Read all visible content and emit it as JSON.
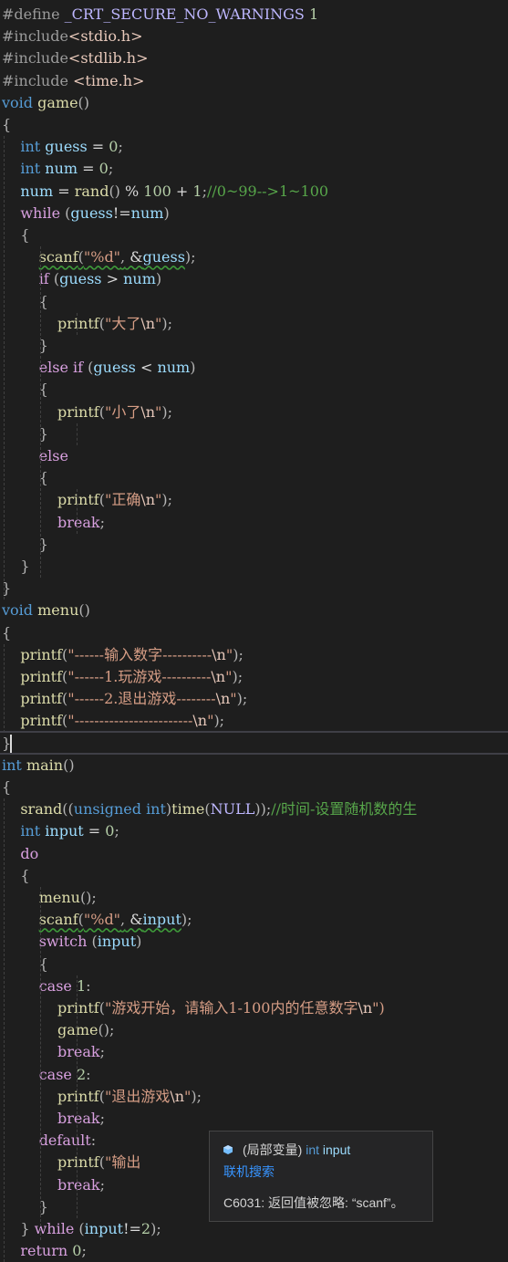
{
  "editor": {
    "lines": [
      [
        [
          "k-pp",
          "#define "
        ],
        [
          "k-macro",
          "_CRT_SECURE_NO_WARNINGS"
        ],
        [
          "k-plain",
          " "
        ],
        [
          "k-num",
          "1"
        ]
      ],
      [
        [
          "k-pp",
          "#include"
        ],
        [
          "k-hdr",
          "<stdio.h>"
        ]
      ],
      [
        [
          "k-pp",
          "#include"
        ],
        [
          "k-hdr",
          "<stdlib.h>"
        ]
      ],
      [
        [
          "k-pp",
          "#include "
        ],
        [
          "k-hdr",
          "<time.h>"
        ]
      ],
      [
        [
          "k-kw",
          "void "
        ],
        [
          "k-fn",
          "game"
        ],
        [
          "k-punc",
          "()"
        ]
      ],
      [
        [
          "k-punc",
          "{"
        ]
      ],
      [
        [
          "k-plain",
          "    "
        ],
        [
          "k-kw",
          "int "
        ],
        [
          "k-var",
          "guess"
        ],
        [
          "k-plain",
          " = "
        ],
        [
          "k-num",
          "0"
        ],
        [
          "k-punc",
          ";"
        ]
      ],
      [
        [
          "k-plain",
          "    "
        ],
        [
          "k-kw",
          "int "
        ],
        [
          "k-var",
          "num"
        ],
        [
          "k-plain",
          " = "
        ],
        [
          "k-num",
          "0"
        ],
        [
          "k-punc",
          ";"
        ]
      ],
      [
        [
          "k-plain",
          "    "
        ],
        [
          "k-var",
          "num"
        ],
        [
          "k-plain",
          " = "
        ],
        [
          "k-fn",
          "rand"
        ],
        [
          "k-punc",
          "()"
        ],
        [
          "k-plain",
          " % "
        ],
        [
          "k-num",
          "100"
        ],
        [
          "k-plain",
          " + "
        ],
        [
          "k-num",
          "1"
        ],
        [
          "k-punc",
          ";"
        ],
        [
          "k-cmt",
          "//0~99-->1~100"
        ]
      ],
      [
        [
          "k-plain",
          "    "
        ],
        [
          "k-ctl",
          "while"
        ],
        [
          "k-plain",
          " "
        ],
        [
          "k-punc",
          "("
        ],
        [
          "k-var",
          "guess"
        ],
        [
          "k-plain",
          "!="
        ],
        [
          "k-var",
          "num"
        ],
        [
          "k-punc",
          ")"
        ]
      ],
      [
        [
          "k-plain",
          "    "
        ],
        [
          "k-punc",
          "{"
        ]
      ],
      [
        [
          "k-plain",
          "        "
        ],
        [
          "k-fn sq",
          "scanf"
        ],
        [
          "k-punc sq",
          "("
        ],
        [
          "k-str sq",
          "\"%d\""
        ],
        [
          "k-punc sq",
          ","
        ],
        [
          "k-plain sq",
          " &"
        ],
        [
          "k-var sq",
          "guess"
        ],
        [
          "k-punc",
          ");"
        ]
      ],
      [
        [
          "k-plain",
          "        "
        ],
        [
          "k-ctl",
          "if"
        ],
        [
          "k-plain",
          " "
        ],
        [
          "k-punc",
          "("
        ],
        [
          "k-var",
          "guess"
        ],
        [
          "k-plain",
          " > "
        ],
        [
          "k-var",
          "num"
        ],
        [
          "k-punc",
          ")"
        ]
      ],
      [
        [
          "k-plain",
          "        "
        ],
        [
          "k-punc",
          "{"
        ]
      ],
      [
        [
          "k-plain",
          "            "
        ],
        [
          "k-fn",
          "printf"
        ],
        [
          "k-punc",
          "("
        ],
        [
          "k-str",
          "\"大了"
        ],
        [
          "k-esc",
          "\\n"
        ],
        [
          "k-str",
          "\""
        ],
        [
          "k-punc",
          ");"
        ]
      ],
      [
        [
          "k-plain",
          "        "
        ],
        [
          "k-punc",
          "}"
        ]
      ],
      [
        [
          "k-plain",
          "        "
        ],
        [
          "k-ctl",
          "else if"
        ],
        [
          "k-plain",
          " "
        ],
        [
          "k-punc",
          "("
        ],
        [
          "k-var",
          "guess"
        ],
        [
          "k-plain",
          " < "
        ],
        [
          "k-var",
          "num"
        ],
        [
          "k-punc",
          ")"
        ]
      ],
      [
        [
          "k-plain",
          "        "
        ],
        [
          "k-punc",
          "{"
        ]
      ],
      [
        [
          "k-plain",
          "            "
        ],
        [
          "k-fn",
          "printf"
        ],
        [
          "k-punc",
          "("
        ],
        [
          "k-str",
          "\"小了"
        ],
        [
          "k-esc",
          "\\n"
        ],
        [
          "k-str",
          "\""
        ],
        [
          "k-punc",
          ");"
        ]
      ],
      [
        [
          "k-plain",
          "        "
        ],
        [
          "k-punc",
          "}"
        ]
      ],
      [
        [
          "k-plain",
          "        "
        ],
        [
          "k-ctl",
          "else"
        ]
      ],
      [
        [
          "k-plain",
          "        "
        ],
        [
          "k-punc",
          "{"
        ]
      ],
      [
        [
          "k-plain",
          "            "
        ],
        [
          "k-fn",
          "printf"
        ],
        [
          "k-punc",
          "("
        ],
        [
          "k-str",
          "\"正确"
        ],
        [
          "k-esc",
          "\\n"
        ],
        [
          "k-str",
          "\""
        ],
        [
          "k-punc",
          ");"
        ]
      ],
      [
        [
          "k-plain",
          "            "
        ],
        [
          "k-ctl",
          "break"
        ],
        [
          "k-punc",
          ";"
        ]
      ],
      [
        [
          "k-plain",
          "        "
        ],
        [
          "k-punc",
          "}"
        ]
      ],
      [
        [
          "k-plain",
          "    "
        ],
        [
          "k-punc",
          "}"
        ]
      ],
      [
        [
          "k-punc",
          "}"
        ]
      ],
      [
        [
          "k-kw",
          "void "
        ],
        [
          "k-fn",
          "menu"
        ],
        [
          "k-punc",
          "()"
        ]
      ],
      [
        [
          "k-punc",
          "{"
        ]
      ],
      [
        [
          "k-plain",
          "    "
        ],
        [
          "k-fn",
          "printf"
        ],
        [
          "k-punc",
          "("
        ],
        [
          "k-str",
          "\"------输入数字----------"
        ],
        [
          "k-esc",
          "\\n"
        ],
        [
          "k-str",
          "\""
        ],
        [
          "k-punc",
          ");"
        ]
      ],
      [
        [
          "k-plain",
          "    "
        ],
        [
          "k-fn",
          "printf"
        ],
        [
          "k-punc",
          "("
        ],
        [
          "k-str",
          "\"------1.玩游戏----------"
        ],
        [
          "k-esc",
          "\\n"
        ],
        [
          "k-str",
          "\""
        ],
        [
          "k-punc",
          ");"
        ]
      ],
      [
        [
          "k-plain",
          "    "
        ],
        [
          "k-fn",
          "printf"
        ],
        [
          "k-punc",
          "("
        ],
        [
          "k-str",
          "\"------2.退出游戏--------"
        ],
        [
          "k-esc",
          "\\n"
        ],
        [
          "k-str",
          "\""
        ],
        [
          "k-punc",
          ");"
        ]
      ],
      [
        [
          "k-plain",
          "    "
        ],
        [
          "k-fn",
          "printf"
        ],
        [
          "k-punc",
          "("
        ],
        [
          "k-str",
          "\"------------------------"
        ],
        [
          "k-esc",
          "\\n"
        ],
        [
          "k-str",
          "\""
        ],
        [
          "k-punc",
          ");"
        ]
      ],
      [
        [
          "k-punc",
          "}"
        ]
      ],
      [
        [
          "k-kw",
          "int "
        ],
        [
          "k-fn",
          "main"
        ],
        [
          "k-punc",
          "()"
        ]
      ],
      [
        [
          "k-punc",
          "{"
        ]
      ],
      [
        [
          "k-plain",
          "    "
        ],
        [
          "k-fn",
          "srand"
        ],
        [
          "k-punc",
          "(("
        ],
        [
          "k-kw",
          "unsigned int"
        ],
        [
          "k-punc",
          ")"
        ],
        [
          "k-fn",
          "time"
        ],
        [
          "k-punc",
          "("
        ],
        [
          "k-macro",
          "NULL"
        ],
        [
          "k-punc",
          "));"
        ],
        [
          "k-cmt",
          "//时间-设置随机数的生"
        ]
      ],
      [
        [
          "k-plain",
          "    "
        ],
        [
          "k-kw",
          "int "
        ],
        [
          "k-var",
          "input"
        ],
        [
          "k-plain",
          " = "
        ],
        [
          "k-num",
          "0"
        ],
        [
          "k-punc",
          ";"
        ]
      ],
      [
        [
          "k-plain",
          "    "
        ],
        [
          "k-ctl",
          "do"
        ]
      ],
      [
        [
          "k-plain",
          "    "
        ],
        [
          "k-punc",
          "{"
        ]
      ],
      [
        [
          "k-plain",
          "        "
        ],
        [
          "k-fn",
          "menu"
        ],
        [
          "k-punc",
          "();"
        ]
      ],
      [
        [
          "k-plain",
          "        "
        ],
        [
          "k-fn sq",
          "scanf"
        ],
        [
          "k-punc sq",
          "("
        ],
        [
          "k-str sq",
          "\"%d\""
        ],
        [
          "k-punc sq",
          ","
        ],
        [
          "k-plain sq",
          " &"
        ],
        [
          "k-var sq",
          "input"
        ],
        [
          "k-punc",
          ");"
        ]
      ],
      [
        [
          "k-plain",
          "        "
        ],
        [
          "k-ctl",
          "switch"
        ],
        [
          "k-plain",
          " "
        ],
        [
          "k-punc",
          "("
        ],
        [
          "k-var",
          "input"
        ],
        [
          "k-punc",
          ")"
        ]
      ],
      [
        [
          "k-plain",
          "        "
        ],
        [
          "k-punc",
          "{"
        ]
      ],
      [
        [
          "k-plain",
          "        "
        ],
        [
          "k-ctl",
          "case "
        ],
        [
          "k-num",
          "1"
        ],
        [
          "k-punc",
          ":"
        ]
      ],
      [
        [
          "k-plain",
          "            "
        ],
        [
          "k-fn",
          "printf"
        ],
        [
          "k-punc",
          "("
        ],
        [
          "k-str",
          "\"游戏开始，请输入1-100内的任意数字"
        ],
        [
          "k-esc",
          "\\n"
        ],
        [
          "k-str",
          "\")"
        ]
      ],
      [
        [
          "k-plain",
          "            "
        ],
        [
          "k-fn",
          "game"
        ],
        [
          "k-punc",
          "();"
        ]
      ],
      [
        [
          "k-plain",
          "            "
        ],
        [
          "k-ctl",
          "break"
        ],
        [
          "k-punc",
          ";"
        ]
      ],
      [
        [
          "k-plain",
          "        "
        ],
        [
          "k-ctl",
          "case "
        ],
        [
          "k-num",
          "2"
        ],
        [
          "k-punc",
          ":"
        ]
      ],
      [
        [
          "k-plain",
          "            "
        ],
        [
          "k-fn",
          "printf"
        ],
        [
          "k-punc",
          "("
        ],
        [
          "k-str",
          "\"退出游戏"
        ],
        [
          "k-esc",
          "\\n"
        ],
        [
          "k-str",
          "\""
        ],
        [
          "k-punc",
          ");"
        ]
      ],
      [
        [
          "k-plain",
          "            "
        ],
        [
          "k-ctl",
          "break"
        ],
        [
          "k-punc",
          ";"
        ]
      ],
      [
        [
          "k-plain",
          "        "
        ],
        [
          "k-ctl",
          "default"
        ],
        [
          "k-punc",
          ":"
        ]
      ],
      [
        [
          "k-plain",
          "            "
        ],
        [
          "k-fn",
          "printf"
        ],
        [
          "k-punc",
          "("
        ],
        [
          "k-str",
          "\"输出"
        ]
      ],
      [
        [
          "k-plain",
          "            "
        ],
        [
          "k-ctl",
          "break"
        ],
        [
          "k-punc",
          ";"
        ]
      ],
      [
        [
          "k-plain",
          "        "
        ],
        [
          "k-punc",
          "}"
        ]
      ],
      [
        [
          "k-plain",
          "    "
        ],
        [
          "k-punc",
          "} "
        ],
        [
          "k-ctl",
          "while"
        ],
        [
          "k-plain",
          " "
        ],
        [
          "k-punc",
          "("
        ],
        [
          "k-var",
          "input"
        ],
        [
          "k-plain",
          "!="
        ],
        [
          "k-num",
          "2"
        ],
        [
          "k-punc",
          ");"
        ]
      ],
      [
        [
          "k-plain",
          "    "
        ],
        [
          "k-ctl",
          "return"
        ],
        [
          "k-plain",
          " "
        ],
        [
          "k-num",
          "0"
        ],
        [
          "k-punc",
          ";"
        ]
      ]
    ]
  },
  "tooltip": {
    "icon": "local-variable-icon",
    "kind": "(局部变量)",
    "type": "int",
    "name": "input",
    "link": "联机搜索",
    "warning": "C6031: 返回值被忽略: “scanf”。"
  },
  "colors": {
    "background": "#1e1e1e",
    "keyword": "#569cd6",
    "control": "#d8a0df",
    "function": "#dcdcaa",
    "variable": "#9cdcfe",
    "number": "#b5cea8",
    "string": "#d69d85",
    "comment": "#57a64a",
    "link": "#3794ff"
  }
}
